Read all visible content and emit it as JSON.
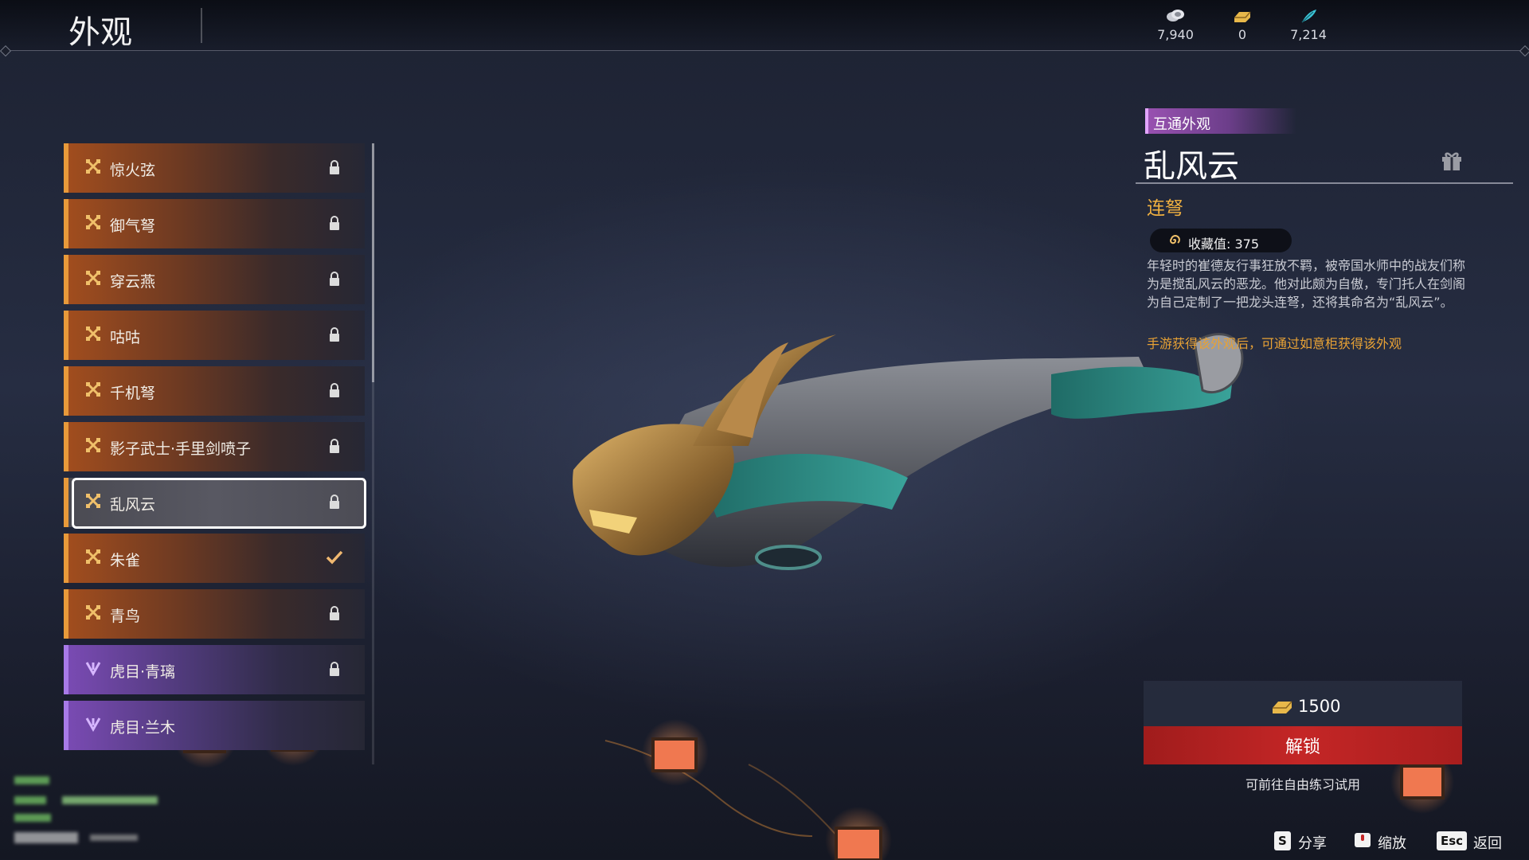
{
  "header": {
    "title": "外观",
    "currencies": [
      {
        "icon": "coin-stack-icon",
        "value": "7,940"
      },
      {
        "icon": "gold-ingot-icon",
        "value": "0"
      },
      {
        "icon": "feather-icon",
        "value": "7,214"
      }
    ]
  },
  "list": {
    "items": [
      {
        "name": "惊火弦",
        "rarity": "orange",
        "state": "locked"
      },
      {
        "name": "御气弩",
        "rarity": "orange",
        "state": "locked"
      },
      {
        "name": "穿云燕",
        "rarity": "orange",
        "state": "locked"
      },
      {
        "name": "咕咕",
        "rarity": "orange",
        "state": "locked"
      },
      {
        "name": "千机弩",
        "rarity": "orange",
        "state": "locked"
      },
      {
        "name": "影子武士·手里剑喷子",
        "rarity": "orange",
        "state": "locked"
      },
      {
        "name": "乱风云",
        "rarity": "orange",
        "state": "locked",
        "selected": true
      },
      {
        "name": "朱雀",
        "rarity": "orange",
        "state": "owned"
      },
      {
        "name": "青鸟",
        "rarity": "orange",
        "state": "locked"
      },
      {
        "name": "虎目·青璃",
        "rarity": "purple",
        "state": "locked"
      },
      {
        "name": "虎目·兰木",
        "rarity": "purple",
        "state": "locked"
      }
    ]
  },
  "detail": {
    "tag": "互通外观",
    "title": "乱风云",
    "type": "连弩",
    "collection_label": "收藏值: 375",
    "description": "年轻时的崔德友行事狂放不羁，被帝国水师中的战友们称为是搅乱风云的恶龙。他对此颇为自傲，专门托人在剑阁为自己定制了一把龙头连弩，还将其命名为“乱风云”。",
    "note": "手游获得该外观后，可通过如意柜获得该外观"
  },
  "purchase": {
    "price": "1500",
    "unlock_label": "解锁",
    "trial_text": "可前往自由练习试用"
  },
  "footer": {
    "hints": [
      {
        "key": "S",
        "label": "分享"
      },
      {
        "key": "",
        "label": "缩放"
      },
      {
        "key": "Esc",
        "label": "返回"
      }
    ]
  },
  "colors": {
    "accent_orange": "#e89a3a",
    "unlock_red": "#c42626",
    "tag_purple": "#9a52b2",
    "type_gold": "#f0b040"
  }
}
